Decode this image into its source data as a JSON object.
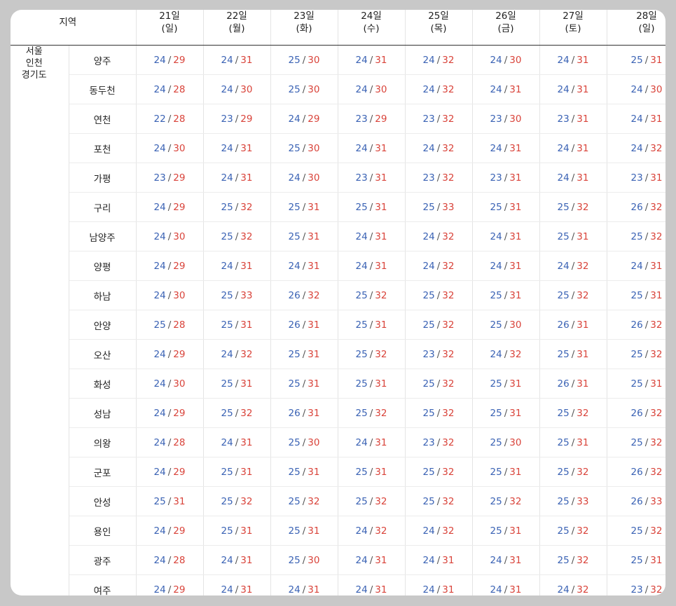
{
  "header": {
    "region_label": "지역",
    "days": [
      {
        "date": "21일",
        "dow": "(일)"
      },
      {
        "date": "22일",
        "dow": "(월)"
      },
      {
        "date": "23일",
        "dow": "(화)"
      },
      {
        "date": "24일",
        "dow": "(수)"
      },
      {
        "date": "25일",
        "dow": "(목)"
      },
      {
        "date": "26일",
        "dow": "(금)"
      },
      {
        "date": "27일",
        "dow": "(토)"
      },
      {
        "date": "28일",
        "dow": "(일)"
      }
    ]
  },
  "region_group": {
    "line1": "서울",
    "line2": "인천",
    "line3": "경기도"
  },
  "separator": "/",
  "colors": {
    "low": "#3a62b4",
    "high": "#d9433a",
    "background": "#c8c8c8"
  },
  "rows": [
    {
      "city": "양주",
      "temps": [
        [
          24,
          29
        ],
        [
          24,
          31
        ],
        [
          25,
          30
        ],
        [
          24,
          31
        ],
        [
          24,
          32
        ],
        [
          24,
          30
        ],
        [
          24,
          31
        ],
        [
          25,
          31
        ]
      ]
    },
    {
      "city": "동두천",
      "temps": [
        [
          24,
          28
        ],
        [
          24,
          30
        ],
        [
          25,
          30
        ],
        [
          24,
          30
        ],
        [
          24,
          32
        ],
        [
          24,
          31
        ],
        [
          24,
          31
        ],
        [
          24,
          30
        ]
      ]
    },
    {
      "city": "연천",
      "temps": [
        [
          22,
          28
        ],
        [
          23,
          29
        ],
        [
          24,
          29
        ],
        [
          23,
          29
        ],
        [
          23,
          32
        ],
        [
          23,
          30
        ],
        [
          23,
          31
        ],
        [
          24,
          31
        ]
      ]
    },
    {
      "city": "포천",
      "temps": [
        [
          24,
          30
        ],
        [
          24,
          31
        ],
        [
          25,
          30
        ],
        [
          24,
          31
        ],
        [
          24,
          32
        ],
        [
          24,
          31
        ],
        [
          24,
          31
        ],
        [
          24,
          32
        ]
      ]
    },
    {
      "city": "가평",
      "temps": [
        [
          23,
          29
        ],
        [
          24,
          31
        ],
        [
          24,
          30
        ],
        [
          23,
          31
        ],
        [
          23,
          32
        ],
        [
          23,
          31
        ],
        [
          24,
          31
        ],
        [
          23,
          31
        ]
      ]
    },
    {
      "city": "구리",
      "temps": [
        [
          24,
          29
        ],
        [
          25,
          32
        ],
        [
          25,
          31
        ],
        [
          25,
          31
        ],
        [
          25,
          33
        ],
        [
          25,
          31
        ],
        [
          25,
          32
        ],
        [
          26,
          32
        ]
      ]
    },
    {
      "city": "남양주",
      "temps": [
        [
          24,
          30
        ],
        [
          25,
          32
        ],
        [
          25,
          31
        ],
        [
          24,
          31
        ],
        [
          24,
          32
        ],
        [
          24,
          31
        ],
        [
          25,
          31
        ],
        [
          25,
          32
        ]
      ]
    },
    {
      "city": "양평",
      "temps": [
        [
          24,
          29
        ],
        [
          24,
          31
        ],
        [
          24,
          31
        ],
        [
          24,
          31
        ],
        [
          24,
          32
        ],
        [
          24,
          31
        ],
        [
          24,
          32
        ],
        [
          24,
          31
        ]
      ]
    },
    {
      "city": "하남",
      "temps": [
        [
          24,
          30
        ],
        [
          25,
          33
        ],
        [
          26,
          32
        ],
        [
          25,
          32
        ],
        [
          25,
          32
        ],
        [
          25,
          31
        ],
        [
          25,
          32
        ],
        [
          25,
          31
        ]
      ]
    },
    {
      "city": "안양",
      "temps": [
        [
          25,
          28
        ],
        [
          25,
          31
        ],
        [
          26,
          31
        ],
        [
          25,
          31
        ],
        [
          25,
          32
        ],
        [
          25,
          30
        ],
        [
          26,
          31
        ],
        [
          26,
          32
        ]
      ]
    },
    {
      "city": "오산",
      "temps": [
        [
          24,
          29
        ],
        [
          24,
          32
        ],
        [
          25,
          31
        ],
        [
          25,
          32
        ],
        [
          23,
          32
        ],
        [
          24,
          32
        ],
        [
          25,
          31
        ],
        [
          25,
          32
        ]
      ]
    },
    {
      "city": "화성",
      "temps": [
        [
          24,
          30
        ],
        [
          25,
          31
        ],
        [
          25,
          31
        ],
        [
          25,
          31
        ],
        [
          25,
          32
        ],
        [
          25,
          31
        ],
        [
          26,
          31
        ],
        [
          25,
          31
        ]
      ]
    },
    {
      "city": "성남",
      "temps": [
        [
          24,
          29
        ],
        [
          25,
          32
        ],
        [
          26,
          31
        ],
        [
          25,
          32
        ],
        [
          25,
          32
        ],
        [
          25,
          31
        ],
        [
          25,
          32
        ],
        [
          26,
          32
        ]
      ]
    },
    {
      "city": "의왕",
      "temps": [
        [
          24,
          28
        ],
        [
          24,
          31
        ],
        [
          25,
          30
        ],
        [
          24,
          31
        ],
        [
          23,
          32
        ],
        [
          25,
          30
        ],
        [
          25,
          31
        ],
        [
          25,
          32
        ]
      ]
    },
    {
      "city": "군포",
      "temps": [
        [
          24,
          29
        ],
        [
          25,
          31
        ],
        [
          25,
          31
        ],
        [
          25,
          31
        ],
        [
          25,
          32
        ],
        [
          25,
          31
        ],
        [
          25,
          32
        ],
        [
          26,
          32
        ]
      ]
    },
    {
      "city": "안성",
      "temps": [
        [
          25,
          31
        ],
        [
          25,
          32
        ],
        [
          25,
          32
        ],
        [
          25,
          32
        ],
        [
          25,
          32
        ],
        [
          25,
          32
        ],
        [
          25,
          33
        ],
        [
          26,
          33
        ]
      ]
    },
    {
      "city": "용인",
      "temps": [
        [
          24,
          29
        ],
        [
          25,
          31
        ],
        [
          25,
          31
        ],
        [
          24,
          32
        ],
        [
          24,
          32
        ],
        [
          25,
          31
        ],
        [
          25,
          32
        ],
        [
          25,
          32
        ]
      ]
    },
    {
      "city": "광주",
      "temps": [
        [
          24,
          28
        ],
        [
          24,
          31
        ],
        [
          25,
          30
        ],
        [
          24,
          31
        ],
        [
          24,
          31
        ],
        [
          24,
          31
        ],
        [
          25,
          32
        ],
        [
          25,
          31
        ]
      ]
    },
    {
      "city": "여주",
      "temps": [
        [
          24,
          29
        ],
        [
          24,
          31
        ],
        [
          24,
          31
        ],
        [
          24,
          31
        ],
        [
          24,
          31
        ],
        [
          24,
          31
        ],
        [
          24,
          32
        ],
        [
          23,
          32
        ]
      ]
    }
  ]
}
